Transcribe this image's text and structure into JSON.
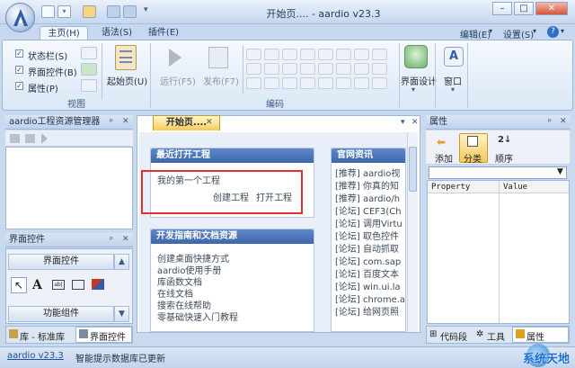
{
  "window": {
    "title": "开始页.... - aardio v23.3",
    "controls": {
      "minimize": "–",
      "maximize": "□",
      "close": "✕"
    }
  },
  "ribbon": {
    "tabs": [
      "主页(H)",
      "语法(S)",
      "插件(E)"
    ],
    "right_menu": {
      "edit": "编辑(E)",
      "settings": "设置(S)",
      "help_icon": "?"
    },
    "view_group": {
      "checkboxes": [
        {
          "label": "状态栏(S)",
          "checked": true
        },
        {
          "label": "界面控件(B)",
          "checked": true
        },
        {
          "label": "属性(P)",
          "checked": true
        }
      ],
      "start_page": "起始页(U)",
      "group_label": "视图"
    },
    "code_group": {
      "run": "运行(F5)",
      "publish": "发布(F7)",
      "group_label": "编码"
    },
    "interface_designer": "界面设计",
    "window_btn": "窗口"
  },
  "project_panel": {
    "title": "aardio工程资源管理器"
  },
  "controls_panel": {
    "title": "界面控件",
    "section1": "界面控件",
    "section2": "功能组件",
    "tabs": [
      "库 - 标准库",
      "界面控件"
    ]
  },
  "doc": {
    "tab_label": "开始页....",
    "recent": {
      "title": "最近打开工程",
      "items": [
        "我的第一个工程"
      ],
      "actions": [
        "创建工程",
        "打开工程"
      ]
    },
    "guides": {
      "title": "开发指南和文档资源",
      "items": [
        "创建桌面快捷方式",
        "aardio使用手册",
        "库函数文档",
        "在线文档",
        "搜索在线帮助",
        "零基础快速入门教程"
      ]
    },
    "news": {
      "title": "官网资讯",
      "items": [
        "[推荐] aardio视",
        "[推荐] 你真的知",
        "[推荐] aardio/h",
        "[论坛] CEF3(Ch",
        "[论坛] 调用Virtu",
        "[论坛] 取色控件",
        "[论坛] 自动抓取",
        "[论坛] com.sap",
        "[论坛] 百度文本",
        "[论坛] win.ui.la",
        "[论坛] chrome.a",
        "[论坛] 给网页照"
      ]
    }
  },
  "properties": {
    "title": "属性",
    "buttons": [
      "添加",
      "分类",
      "顺序"
    ],
    "columns": [
      "Property",
      "Value"
    ],
    "bottom_tabs": [
      "代码段",
      "工具",
      "属性"
    ]
  },
  "status": {
    "version": "aardio v23.3",
    "message": "智能提示数据库已更新",
    "watermark": "系统天地"
  },
  "colors": {
    "accent": "#3e66aa",
    "highlight": "#e03131",
    "tab_active": "#f6c85a"
  }
}
